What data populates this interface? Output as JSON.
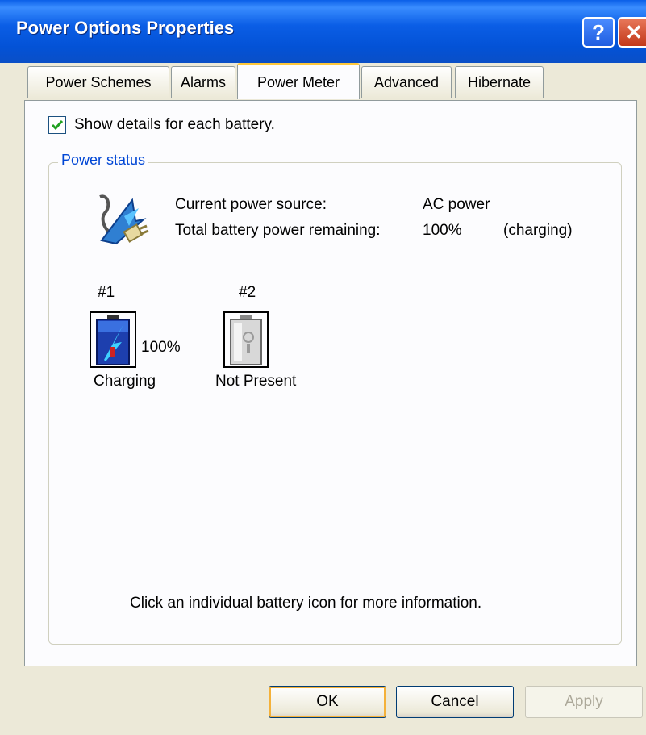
{
  "window": {
    "title": "Power Options Properties",
    "help_label": "?",
    "close_label": "✕"
  },
  "tabs": [
    {
      "label": "Power Schemes"
    },
    {
      "label": "Alarms"
    },
    {
      "label": "Power Meter",
      "active": true
    },
    {
      "label": "Advanced"
    },
    {
      "label": "Hibernate"
    }
  ],
  "power_meter": {
    "show_details_label": "Show details for each battery.",
    "show_details_checked": true,
    "group_title": "Power status",
    "current_source_label": "Current power source:",
    "current_source_value": "AC power",
    "total_remaining_label": "Total battery power remaining:",
    "total_remaining_value": "100%",
    "total_remaining_status": "(charging)",
    "batteries": [
      {
        "number": "#1",
        "percent": "100%",
        "status": "Charging",
        "charge_fraction": 1.0
      },
      {
        "number": "#2",
        "percent": "",
        "status": "Not Present",
        "charge_fraction": 0
      }
    ],
    "hint": "Click an individual battery icon for more information."
  },
  "buttons": {
    "ok": "OK",
    "cancel": "Cancel",
    "apply": "Apply"
  },
  "colors": {
    "titlebar": "#0a5fe8",
    "active_tab_accent": "#ffc83c",
    "group_title": "#0046d5"
  }
}
